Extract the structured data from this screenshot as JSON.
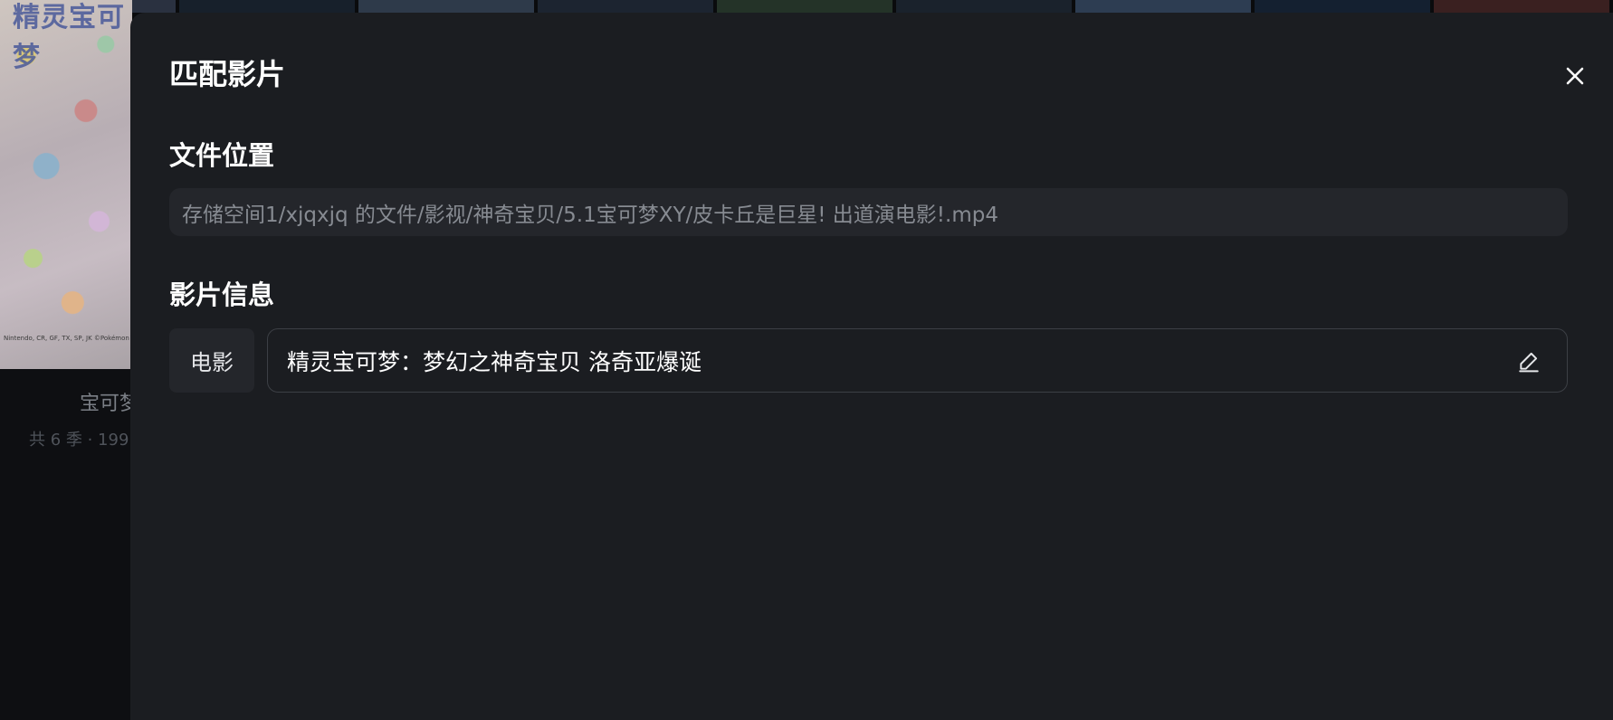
{
  "background": {
    "poster_title": "精灵宝可梦",
    "poster_credit": "Nintendo, CR, GF, TX, SP, JK ©Pokémon",
    "show_title": "宝可梦",
    "show_meta": "共 6 季 · 199",
    "strip_colors": [
      "#2a3140",
      "#17202b",
      "#2e3a4a",
      "#1c2430",
      "#243328",
      "#1a222c",
      "#2d3d52",
      "#142030",
      "#3a2020"
    ]
  },
  "modal": {
    "title": "匹配影片",
    "close_icon": "close-icon",
    "file_section": {
      "label": "文件位置",
      "path": "存储空间1/xjqxjq 的文件/影视/神奇宝贝/5.1宝可梦XY/皮卡丘是巨星! 出道演电影!.mp4"
    },
    "info_section": {
      "label": "影片信息",
      "type_tag": "电影",
      "movie_title": "精灵宝可梦：梦幻之神奇宝贝 洛奇亚爆诞",
      "edit_icon": "edit-pencil-icon"
    }
  },
  "colors": {
    "modal_bg": "#1b1d21",
    "field_bg": "#24262b",
    "field_border": "#3c3f45",
    "text_primary": "#ffffff",
    "text_muted": "#878b92"
  }
}
